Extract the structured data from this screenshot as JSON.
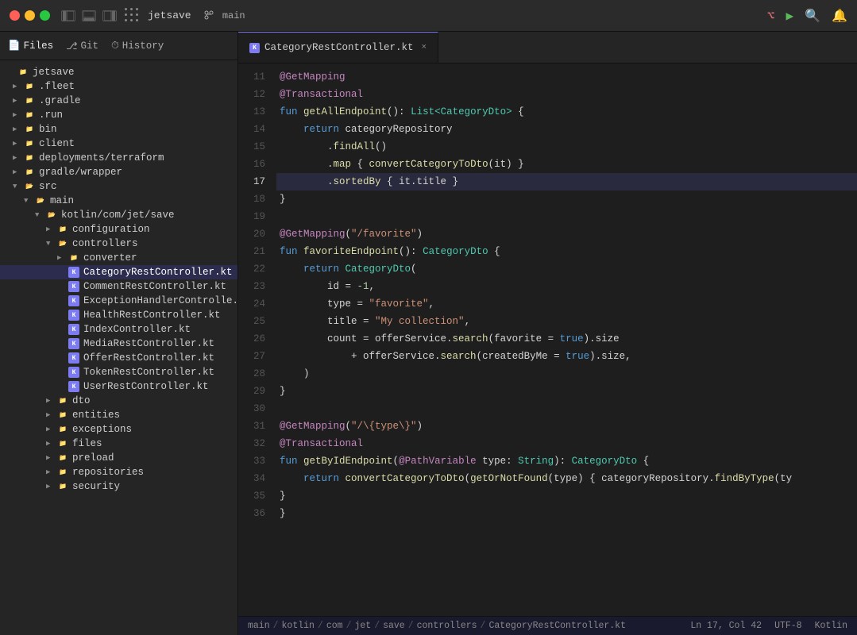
{
  "titlebar": {
    "project": "jetsave",
    "branch": "main",
    "icons": {
      "grid": "grid-icon",
      "sidebar_left": "sidebar-left-icon",
      "sidebar_right": "sidebar-right-icon",
      "sidebar_bottom": "sidebar-bottom-icon"
    },
    "right": {
      "broadcast": "⌥",
      "run": "▶",
      "search": "⌕",
      "notifications": "🔔"
    }
  },
  "tab": {
    "label": "CategoryRestController.kt",
    "icon": "K",
    "close": "×"
  },
  "sidebar": {
    "tabs": [
      {
        "id": "files",
        "label": "Files",
        "icon": "📄"
      },
      {
        "id": "git",
        "label": "Git",
        "icon": "⎇"
      },
      {
        "id": "history",
        "label": "History",
        "icon": "⏱"
      }
    ],
    "root": "jetsave",
    "tree": [
      {
        "id": "fleet",
        "label": ".fleet",
        "type": "folder",
        "depth": 0,
        "expanded": false
      },
      {
        "id": "gradle",
        "label": ".gradle",
        "type": "folder",
        "depth": 0,
        "expanded": false
      },
      {
        "id": "run",
        "label": ".run",
        "type": "folder",
        "depth": 0,
        "expanded": false
      },
      {
        "id": "bin",
        "label": "bin",
        "type": "folder",
        "depth": 0,
        "expanded": false
      },
      {
        "id": "client",
        "label": "client",
        "type": "folder",
        "depth": 0,
        "expanded": false
      },
      {
        "id": "deployments",
        "label": "deployments/terraform",
        "type": "folder",
        "depth": 0,
        "expanded": false
      },
      {
        "id": "gradlewrapper",
        "label": "gradle/wrapper",
        "type": "folder",
        "depth": 0,
        "expanded": false
      },
      {
        "id": "src",
        "label": "src",
        "type": "folder",
        "depth": 0,
        "expanded": true
      },
      {
        "id": "main",
        "label": "main",
        "type": "folder",
        "depth": 1,
        "expanded": true
      },
      {
        "id": "kotlin",
        "label": "kotlin/com/jet/save",
        "type": "folder",
        "depth": 2,
        "expanded": true
      },
      {
        "id": "configuration",
        "label": "configuration",
        "type": "folder",
        "depth": 3,
        "expanded": false
      },
      {
        "id": "controllers",
        "label": "controllers",
        "type": "folder",
        "depth": 3,
        "expanded": true
      },
      {
        "id": "converter",
        "label": "converter",
        "type": "folder",
        "depth": 4,
        "expanded": false
      },
      {
        "id": "categoryrestcontroller",
        "label": "CategoryRestController.kt",
        "type": "kt",
        "depth": 4,
        "selected": true
      },
      {
        "id": "commentrestcontroller",
        "label": "CommentRestController.kt",
        "type": "kt",
        "depth": 4
      },
      {
        "id": "exceptionhandler",
        "label": "ExceptionHandlerControlle...",
        "type": "kt",
        "depth": 4
      },
      {
        "id": "healthrestcontroller",
        "label": "HealthRestController.kt",
        "type": "kt",
        "depth": 4
      },
      {
        "id": "indexcontroller",
        "label": "IndexController.kt",
        "type": "kt",
        "depth": 4
      },
      {
        "id": "mediarestcontroller",
        "label": "MediaRestController.kt",
        "type": "kt",
        "depth": 4
      },
      {
        "id": "offerrestcontroller",
        "label": "OfferRestController.kt",
        "type": "kt",
        "depth": 4
      },
      {
        "id": "tokenrestcontroller",
        "label": "TokenRestController.kt",
        "type": "kt",
        "depth": 4
      },
      {
        "id": "userrestcontroller",
        "label": "UserRestController.kt",
        "type": "kt",
        "depth": 4
      },
      {
        "id": "dto",
        "label": "dto",
        "type": "folder",
        "depth": 3,
        "expanded": false
      },
      {
        "id": "entities",
        "label": "entities",
        "type": "folder",
        "depth": 3,
        "expanded": false
      },
      {
        "id": "exceptions",
        "label": "exceptions",
        "type": "folder",
        "depth": 3,
        "expanded": false
      },
      {
        "id": "files",
        "label": "files",
        "type": "folder",
        "depth": 3,
        "expanded": false
      },
      {
        "id": "preload",
        "label": "preload",
        "type": "folder",
        "depth": 3,
        "expanded": false
      },
      {
        "id": "repositories",
        "label": "repositories",
        "type": "folder",
        "depth": 3,
        "expanded": false
      },
      {
        "id": "security",
        "label": "security",
        "type": "folder",
        "depth": 3,
        "expanded": false
      }
    ]
  },
  "editor": {
    "filename": "CategoryRestController.kt"
  },
  "statusbar": {
    "breadcrumb": [
      "main",
      "kotlin",
      "com",
      "jet",
      "save",
      "controllers",
      "CategoryRestController.kt"
    ],
    "ln": "Ln 17, Col 42",
    "encoding": "UTF-8",
    "filetype": "Kotlin"
  },
  "code": {
    "lines": [
      {
        "num": 11,
        "tokens": [
          {
            "t": "annotation",
            "v": "@GetMapping"
          }
        ]
      },
      {
        "num": 12,
        "tokens": [
          {
            "t": "annotation",
            "v": "@Transactional"
          }
        ]
      },
      {
        "num": 13,
        "tokens": [
          {
            "t": "keyword",
            "v": "fun "
          },
          {
            "t": "function",
            "v": "getAllEndpoint"
          },
          {
            "t": "plain",
            "v": "(): "
          },
          {
            "t": "type",
            "v": "List<CategoryDto>"
          },
          {
            "t": "plain",
            "v": " {"
          }
        ]
      },
      {
        "num": 14,
        "tokens": [
          {
            "t": "plain",
            "v": "    "
          },
          {
            "t": "keyword",
            "v": "return "
          },
          {
            "t": "plain",
            "v": "categoryRepository"
          }
        ]
      },
      {
        "num": 15,
        "tokens": [
          {
            "t": "plain",
            "v": "        ."
          },
          {
            "t": "method",
            "v": "findAll"
          },
          {
            "t": "plain",
            "v": "()"
          }
        ]
      },
      {
        "num": 16,
        "tokens": [
          {
            "t": "plain",
            "v": "        ."
          },
          {
            "t": "method",
            "v": "map"
          },
          {
            "t": "plain",
            "v": " { "
          },
          {
            "t": "method",
            "v": "convertCategoryToDto"
          },
          {
            "t": "plain",
            "v": "(it) }"
          }
        ]
      },
      {
        "num": 17,
        "tokens": [
          {
            "t": "plain",
            "v": "        ."
          },
          {
            "t": "method",
            "v": "sortedBy"
          },
          {
            "t": "plain",
            "v": " { it.title }"
          }
        ],
        "highlighted": true
      },
      {
        "num": 18,
        "tokens": [
          {
            "t": "plain",
            "v": "}"
          }
        ]
      },
      {
        "num": 19,
        "tokens": []
      },
      {
        "num": 20,
        "tokens": [
          {
            "t": "annotation",
            "v": "@GetMapping"
          },
          {
            "t": "plain",
            "v": "("
          },
          {
            "t": "string",
            "v": "\"/favorite\""
          },
          {
            "t": "plain",
            "v": ")"
          }
        ]
      },
      {
        "num": 21,
        "tokens": [
          {
            "t": "keyword",
            "v": "fun "
          },
          {
            "t": "function",
            "v": "favoriteEndpoint"
          },
          {
            "t": "plain",
            "v": "(): "
          },
          {
            "t": "type",
            "v": "CategoryDto"
          },
          {
            "t": "plain",
            "v": " {"
          }
        ]
      },
      {
        "num": 22,
        "tokens": [
          {
            "t": "plain",
            "v": "    "
          },
          {
            "t": "keyword",
            "v": "return "
          },
          {
            "t": "type",
            "v": "CategoryDto"
          },
          {
            "t": "plain",
            "v": "("
          }
        ]
      },
      {
        "num": 23,
        "tokens": [
          {
            "t": "plain",
            "v": "        id = "
          },
          {
            "t": "number",
            "v": "-1"
          },
          {
            "t": "plain",
            "v": ","
          }
        ]
      },
      {
        "num": 24,
        "tokens": [
          {
            "t": "plain",
            "v": "        type = "
          },
          {
            "t": "string",
            "v": "\"favorite\""
          },
          {
            "t": "plain",
            "v": ","
          }
        ]
      },
      {
        "num": 25,
        "tokens": [
          {
            "t": "plain",
            "v": "        title = "
          },
          {
            "t": "string",
            "v": "\"My collection\""
          },
          {
            "t": "plain",
            "v": ","
          }
        ]
      },
      {
        "num": 26,
        "tokens": [
          {
            "t": "plain",
            "v": "        count = offerService."
          },
          {
            "t": "method",
            "v": "search"
          },
          {
            "t": "plain",
            "v": "(favorite = "
          },
          {
            "t": "bool",
            "v": "true"
          },
          {
            "t": "plain",
            "v": ").size"
          }
        ]
      },
      {
        "num": 27,
        "tokens": [
          {
            "t": "plain",
            "v": "            + offerService."
          },
          {
            "t": "method",
            "v": "search"
          },
          {
            "t": "plain",
            "v": "(createdByMe = "
          },
          {
            "t": "bool",
            "v": "true"
          },
          {
            "t": "plain",
            "v": ").size,"
          }
        ]
      },
      {
        "num": 28,
        "tokens": [
          {
            "t": "plain",
            "v": "    )"
          }
        ]
      },
      {
        "num": 29,
        "tokens": [
          {
            "t": "plain",
            "v": "}"
          }
        ]
      },
      {
        "num": 30,
        "tokens": []
      },
      {
        "num": 31,
        "tokens": [
          {
            "t": "annotation",
            "v": "@GetMapping"
          },
          {
            "t": "plain",
            "v": "("
          },
          {
            "t": "string",
            "v": "\"/\\{type\\}\""
          },
          {
            "t": "plain",
            "v": ")"
          }
        ]
      },
      {
        "num": 32,
        "tokens": [
          {
            "t": "annotation",
            "v": "@Transactional"
          }
        ]
      },
      {
        "num": 33,
        "tokens": [
          {
            "t": "keyword",
            "v": "fun "
          },
          {
            "t": "function",
            "v": "getByIdEndpoint"
          },
          {
            "t": "plain",
            "v": "("
          },
          {
            "t": "annotation",
            "v": "@PathVariable"
          },
          {
            "t": "plain",
            "v": " type: "
          },
          {
            "t": "type",
            "v": "String"
          },
          {
            "t": "plain",
            "v": "): "
          },
          {
            "t": "type",
            "v": "CategoryDto"
          },
          {
            "t": "plain",
            "v": " {"
          }
        ]
      },
      {
        "num": 34,
        "tokens": [
          {
            "t": "plain",
            "v": "    "
          },
          {
            "t": "keyword",
            "v": "return "
          },
          {
            "t": "method",
            "v": "convertCategoryToDto"
          },
          {
            "t": "plain",
            "v": "("
          },
          {
            "t": "method",
            "v": "getOrNotFound"
          },
          {
            "t": "plain",
            "v": "(type) { categoryRepository."
          },
          {
            "t": "method",
            "v": "findByType"
          },
          {
            "t": "plain",
            "v": "(ty"
          }
        ]
      },
      {
        "num": 35,
        "tokens": [
          {
            "t": "plain",
            "v": "}"
          }
        ]
      },
      {
        "num": 36,
        "tokens": [
          {
            "t": "plain",
            "v": "}"
          }
        ]
      }
    ]
  }
}
